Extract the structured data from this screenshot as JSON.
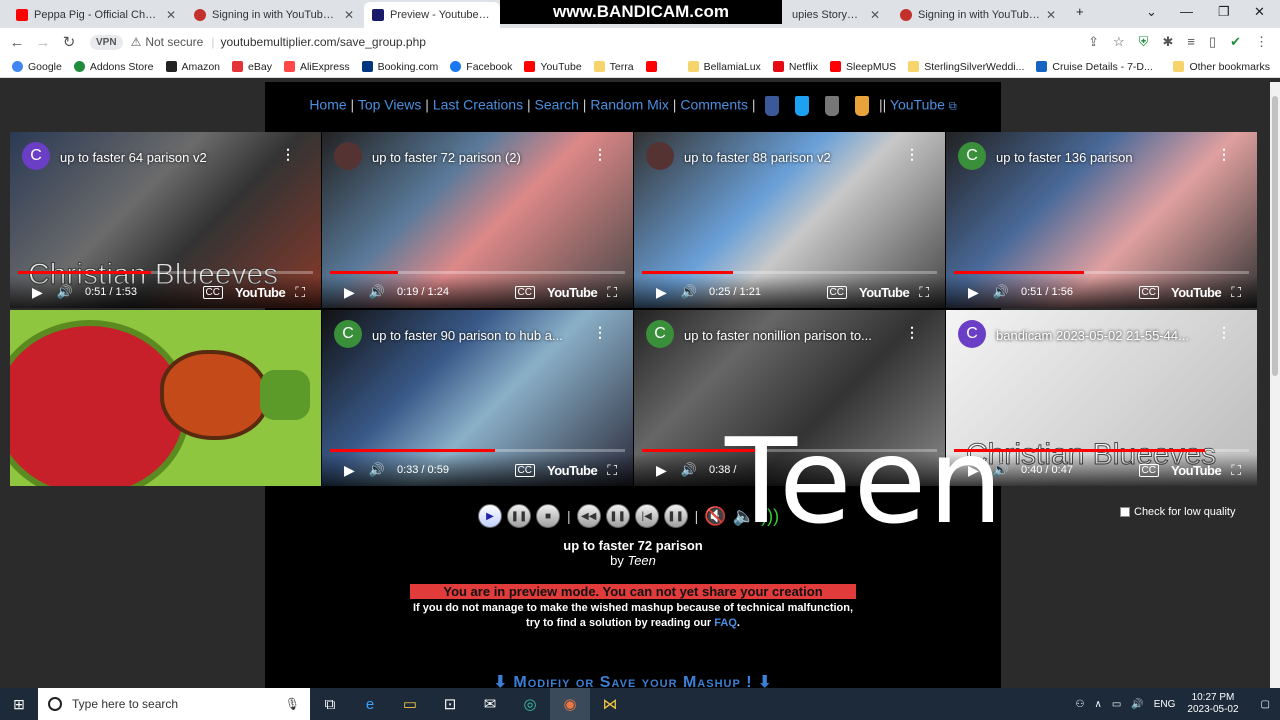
{
  "browser": {
    "tabs": [
      {
        "label": "Peppa Pig - Official Channel -",
        "color": "#ff0000"
      },
      {
        "label": "Signing in with YouTube is co",
        "color": "#c4302b"
      },
      {
        "label": "Preview - Youtube Multip",
        "color": "#1a1a6a"
      },
      {
        "label": "upies Storyboard c",
        "color": "#1e88e5"
      },
      {
        "label": "Signing in with YouTube is co",
        "color": "#c4302b"
      }
    ],
    "recorder_watermark": "www.BANDICAM.com",
    "vpn_label": "VPN",
    "not_secure": "Not secure",
    "url": "youtubemultiplier.com/save_group.php",
    "bookmarks": [
      "Google",
      "Addons Store",
      "Amazon",
      "eBay",
      "AliExpress",
      "Booking.com",
      "Facebook",
      "YouTube",
      "Terra",
      "",
      "BellamiaLux",
      "Netflix",
      "SleepMUS",
      "SterlingSilverWeddi...",
      "Cruise Details - 7-D..."
    ],
    "other_bookmarks": "Other bookmarks"
  },
  "site": {
    "nav": [
      "Home",
      "Top Views",
      "Last Creations",
      "Search",
      "Random Mix",
      "Comments"
    ],
    "nav_youtube": "YouTube"
  },
  "videos": [
    {
      "title": "up to faster 64 parison v2",
      "time": "0:51 / 1:53",
      "avatar": "C",
      "avatar_color": "#6a3fc6",
      "progress": 0.45
    },
    {
      "title": "up to faster 72 parison (2)",
      "time": "0:19 / 1:24",
      "avatar": "",
      "avatar_color": "#553333",
      "progress": 0.23
    },
    {
      "title": "up to faster 88 parison v2",
      "time": "0:25 / 1:21",
      "avatar": "",
      "avatar_color": "#553333",
      "progress": 0.31
    },
    {
      "title": "up to faster 136 parison",
      "time": "0:51 / 1:56",
      "avatar": "C",
      "avatar_color": "#3a8f3a",
      "progress": 0.44
    },
    {
      "title": "",
      "time": "",
      "avatar": "",
      "avatar_color": "",
      "progress": 0
    },
    {
      "title": "up to faster 90 parison to hub a...",
      "time": "0:33 / 0:59",
      "avatar": "C",
      "avatar_color": "#3a8f3a",
      "progress": 0.56
    },
    {
      "title": "up to faster nonillion parison to...",
      "time": "0:38 /",
      "avatar": "C",
      "avatar_color": "#3a8f3a",
      "progress": 0.4
    },
    {
      "title": "bandicam 2023-05-02 21-55-44...",
      "time": "0:40 / 0:47",
      "avatar": "C",
      "avatar_color": "#6a3fc6",
      "progress": 0.85
    }
  ],
  "watermark_name": "Christian Blueeves",
  "player": {
    "overlay_text": "Teen",
    "low_quality_label": "Check for low quality",
    "song_title": "up to faster 72 parison",
    "by_prefix": "by",
    "by_author": "Teen"
  },
  "notice": {
    "warning": "You are in preview mode. You can not yet share your creation",
    "info_line1": "If you do not manage to make the wished mashup because of technical malfunction,",
    "info_line2": "try to find a solution by reading our",
    "faq": "FAQ",
    "modify": "Modifiy or Save your Mashup !"
  },
  "taskbar": {
    "search_placeholder": "Type here to search",
    "lang": "ENG",
    "time": "10:27 PM",
    "date": "2023-05-02"
  }
}
